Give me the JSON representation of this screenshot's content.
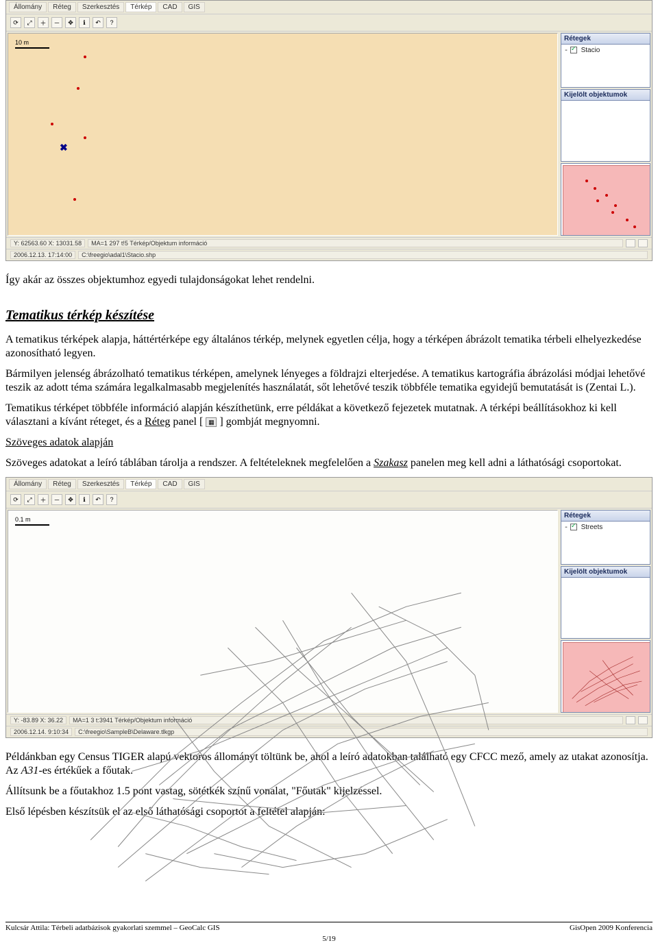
{
  "app1": {
    "menu": [
      "Állomány",
      "Réteg",
      "Szerkesztés",
      "Térkép",
      "CAD",
      "GIS"
    ],
    "scale": "10 m",
    "panels": {
      "layers_title": "Rétegek",
      "layers_entry": "Stacio",
      "selected_title": "Kijelölt objektumok"
    },
    "status": {
      "coord": "Y: 62563.60  X: 13031.58",
      "mid": "MA=1   297   t!5   Térkép/Objektum információ",
      "time": "2006.12.13. 17:14:00",
      "path": "C:\\freegio\\adal1\\Stacio.shp"
    }
  },
  "text": {
    "p1": "Így akár az összes objektumhoz egyedi tulajdonságokat lehet rendelni.",
    "h2": "Tematikus térkép készítése",
    "p2": "A tematikus térképek alapja, háttértérképe egy általános térkép, melynek egyetlen célja, hogy a térképen ábrázolt tematika térbeli elhelyezkedése azonosítható legyen.",
    "p3": "Bármilyen jelenség ábrázolható tematikus térképen, amelynek lényeges a földrajzi elterjedése. A tematikus kartográfia ábrázolási módjai lehetővé teszik az adott téma számára legalkalmasabb megjelenítés használatát, sőt lehetővé teszik többféle tematika egyidejű bemutatását is (Zentai L.).",
    "p4a": "Tematikus térképet többféle információ alapján készíthetünk, erre példákat a következő fejezetek mutatnak. A térképi beállításokhoz ki kell választani a kívánt réteget, és a ",
    "p4_link": "Réteg",
    "p4b": " panel [",
    "p4c": "] gombját megnyomni.",
    "sub1": "Szöveges adatok alapján",
    "p5a": "Szöveges adatokat a leíró táblában tárolja a rendszer. A feltételeknek megfelelően a ",
    "p5_link": "Szakasz",
    "p5b": " panelen meg kell adni a láthatósági csoportokat.",
    "p6": "Példánkban egy Census TIGER alapú vektoros állományt töltünk be, ahol a leíró adatokban található egy CFCC mező, amely az utakat azonosítja. Az ",
    "p6_i": "A31",
    "p6b": "-es értékűek a főutak.",
    "p7": "Állítsunk be a főutakhoz 1.5 pont vastag, sötétkék színű vonalat, \"Főutak\" kijelzéssel.",
    "p8": "Első lépésben készítsük el az első láthatósági csoportot a feltétel alapján:"
  },
  "app2": {
    "menu": [
      "Állomány",
      "Réteg",
      "Szerkesztés",
      "Térkép",
      "CAD",
      "GIS"
    ],
    "scale": "0.1 m",
    "panels": {
      "layers_title": "Rétegek",
      "layers_entry": "Streets",
      "selected_title": "Kijelölt objektumok"
    },
    "status": {
      "coord": "Y: -83.89  X: 36.22",
      "mid": "MA=1   3   t:3941   Térkép/Objektum információ",
      "time": "2006.12.14. 9:10:34",
      "path": "C:\\freegio\\SampleB\\Delaware.tlkgp"
    }
  },
  "footer": {
    "left": "Kulcsár Attila: Térbeli adatbázisok gyakorlati szemmel – GeoCalc GIS",
    "right": "GisOpen 2009 Konferencia",
    "page": "5/19"
  }
}
